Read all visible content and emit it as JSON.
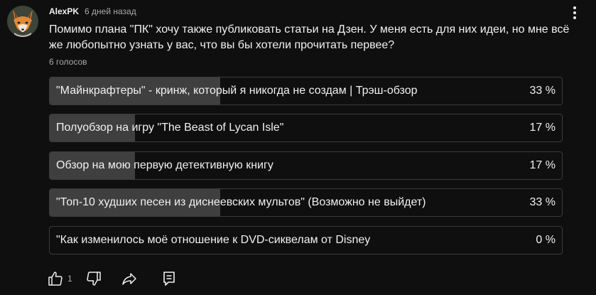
{
  "post": {
    "author": "AlexPK",
    "time": "6 дней назад",
    "text": "Помимо плана \"ПК\" хочу также публиковать статьи на Дзен. У меня есть для них идеи, но мне всё же любопытно узнать у вас, что вы бы хотели прочитать первее?",
    "votes": "6 голосов"
  },
  "poll": {
    "options": [
      {
        "label": "\"Майнкрафтеры\" - кринж, который я никогда не создам | Трэш-обзор",
        "percent": "33 %",
        "fraction": 0.333
      },
      {
        "label": "Полуобзор на игру \"The Beast of Lycan Isle\"",
        "percent": "17 %",
        "fraction": 0.167
      },
      {
        "label": "Обзор на мою первую детективную книгу",
        "percent": "17 %",
        "fraction": 0.167
      },
      {
        "label": "\"Топ-10 худших песен из диснеевских мультов\" (Возможно не выйдет)",
        "percent": "33 %",
        "fraction": 0.333
      },
      {
        "label": "\"Как изменилось моё отношение к DVD-сиквелам от Disney",
        "percent": "0 %",
        "fraction": 0
      }
    ]
  },
  "actions": {
    "like_count": "1",
    "icons": [
      "thumbs-up-icon",
      "thumbs-down-icon",
      "share-icon",
      "comment-icon"
    ]
  },
  "colors": {
    "background": "#0f0f0f",
    "text": "#f1f1f1",
    "secondary_text": "#aaaaaa",
    "option_border": "#3b3b3b",
    "option_fill": "#3f3f3f"
  }
}
